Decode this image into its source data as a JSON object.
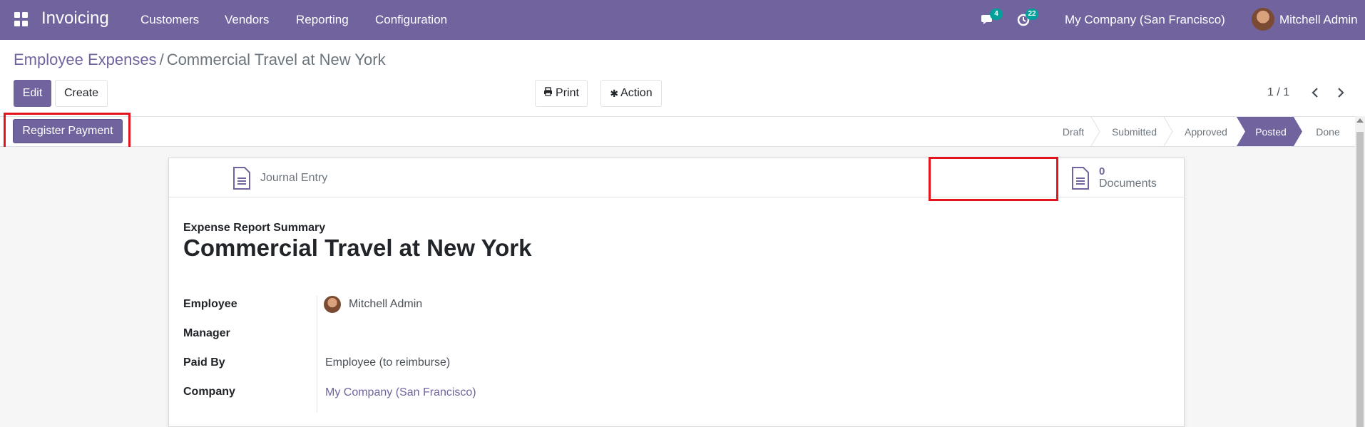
{
  "app": {
    "name": "Invoicing"
  },
  "navbar": {
    "menu": [
      "Customers",
      "Vendors",
      "Reporting",
      "Configuration"
    ],
    "messages_count": "4",
    "activities_count": "22",
    "company": "My Company (San Francisco)",
    "user": "Mitchell Admin"
  },
  "breadcrumb": {
    "parent": "Employee Expenses",
    "separator": "/",
    "current": "Commercial Travel at New York"
  },
  "toolbar": {
    "edit": "Edit",
    "create": "Create",
    "print": "Print",
    "action": "Action"
  },
  "pager": {
    "value": "1 / 1"
  },
  "statusbar": {
    "register_payment": "Register Payment",
    "stages": [
      "Draft",
      "Submitted",
      "Approved",
      "Posted",
      "Done"
    ],
    "active_stage": "Posted"
  },
  "smart_buttons": {
    "journal_entry": "Journal Entry",
    "documents_count": "0",
    "documents_label": "Documents"
  },
  "form": {
    "subtitle": "Expense Report Summary",
    "title": "Commercial Travel at New York",
    "fields": {
      "employee_label": "Employee",
      "employee_value": "Mitchell Admin",
      "manager_label": "Manager",
      "manager_value": "",
      "paid_by_label": "Paid By",
      "paid_by_value": "Employee (to reimburse)",
      "company_label": "Company",
      "company_value": "My Company (San Francisco)"
    }
  },
  "colors": {
    "brand": "#71639e",
    "highlight": "#e3141d",
    "badge": "#00a09d"
  }
}
